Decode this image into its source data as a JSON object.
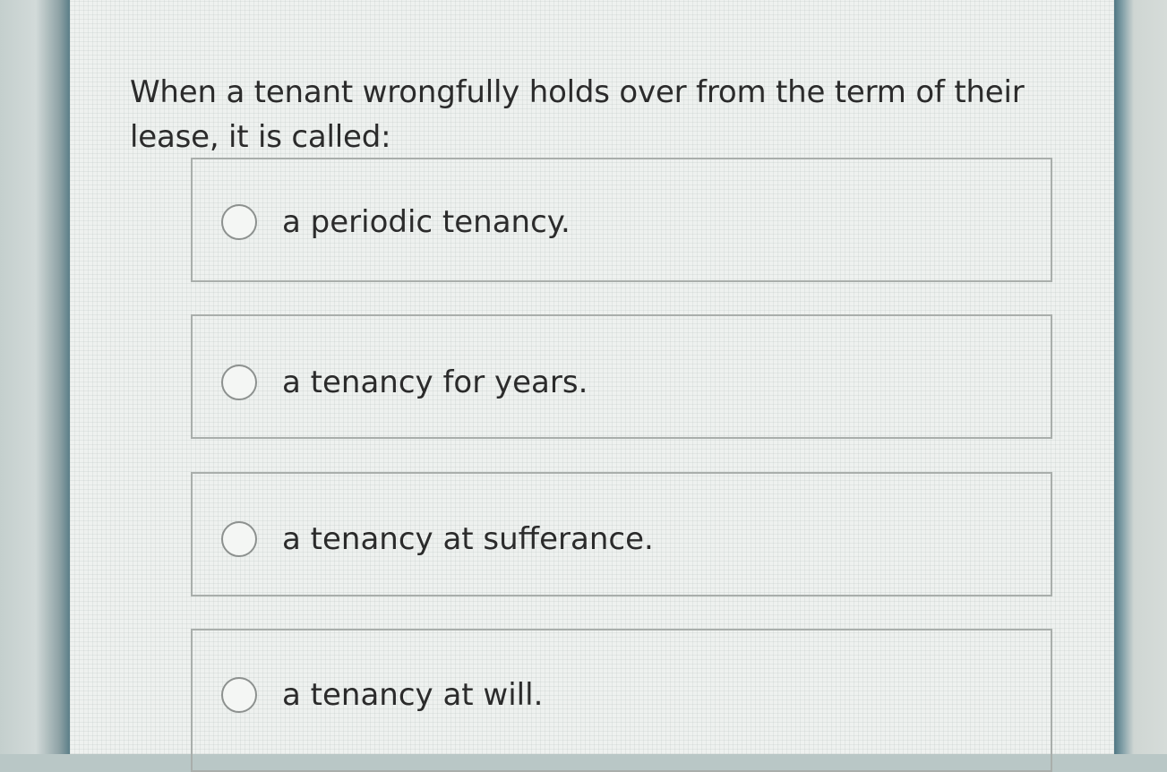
{
  "question": {
    "text": "When a tenant wrongfully holds over from the term of their lease, it is called:"
  },
  "options": [
    {
      "label": "a periodic tenancy.",
      "selected": false
    },
    {
      "label": "a tenancy for years.",
      "selected": false
    },
    {
      "label": "a tenancy at sufferance.",
      "selected": false
    },
    {
      "label": "a tenancy at will.",
      "selected": false
    }
  ]
}
